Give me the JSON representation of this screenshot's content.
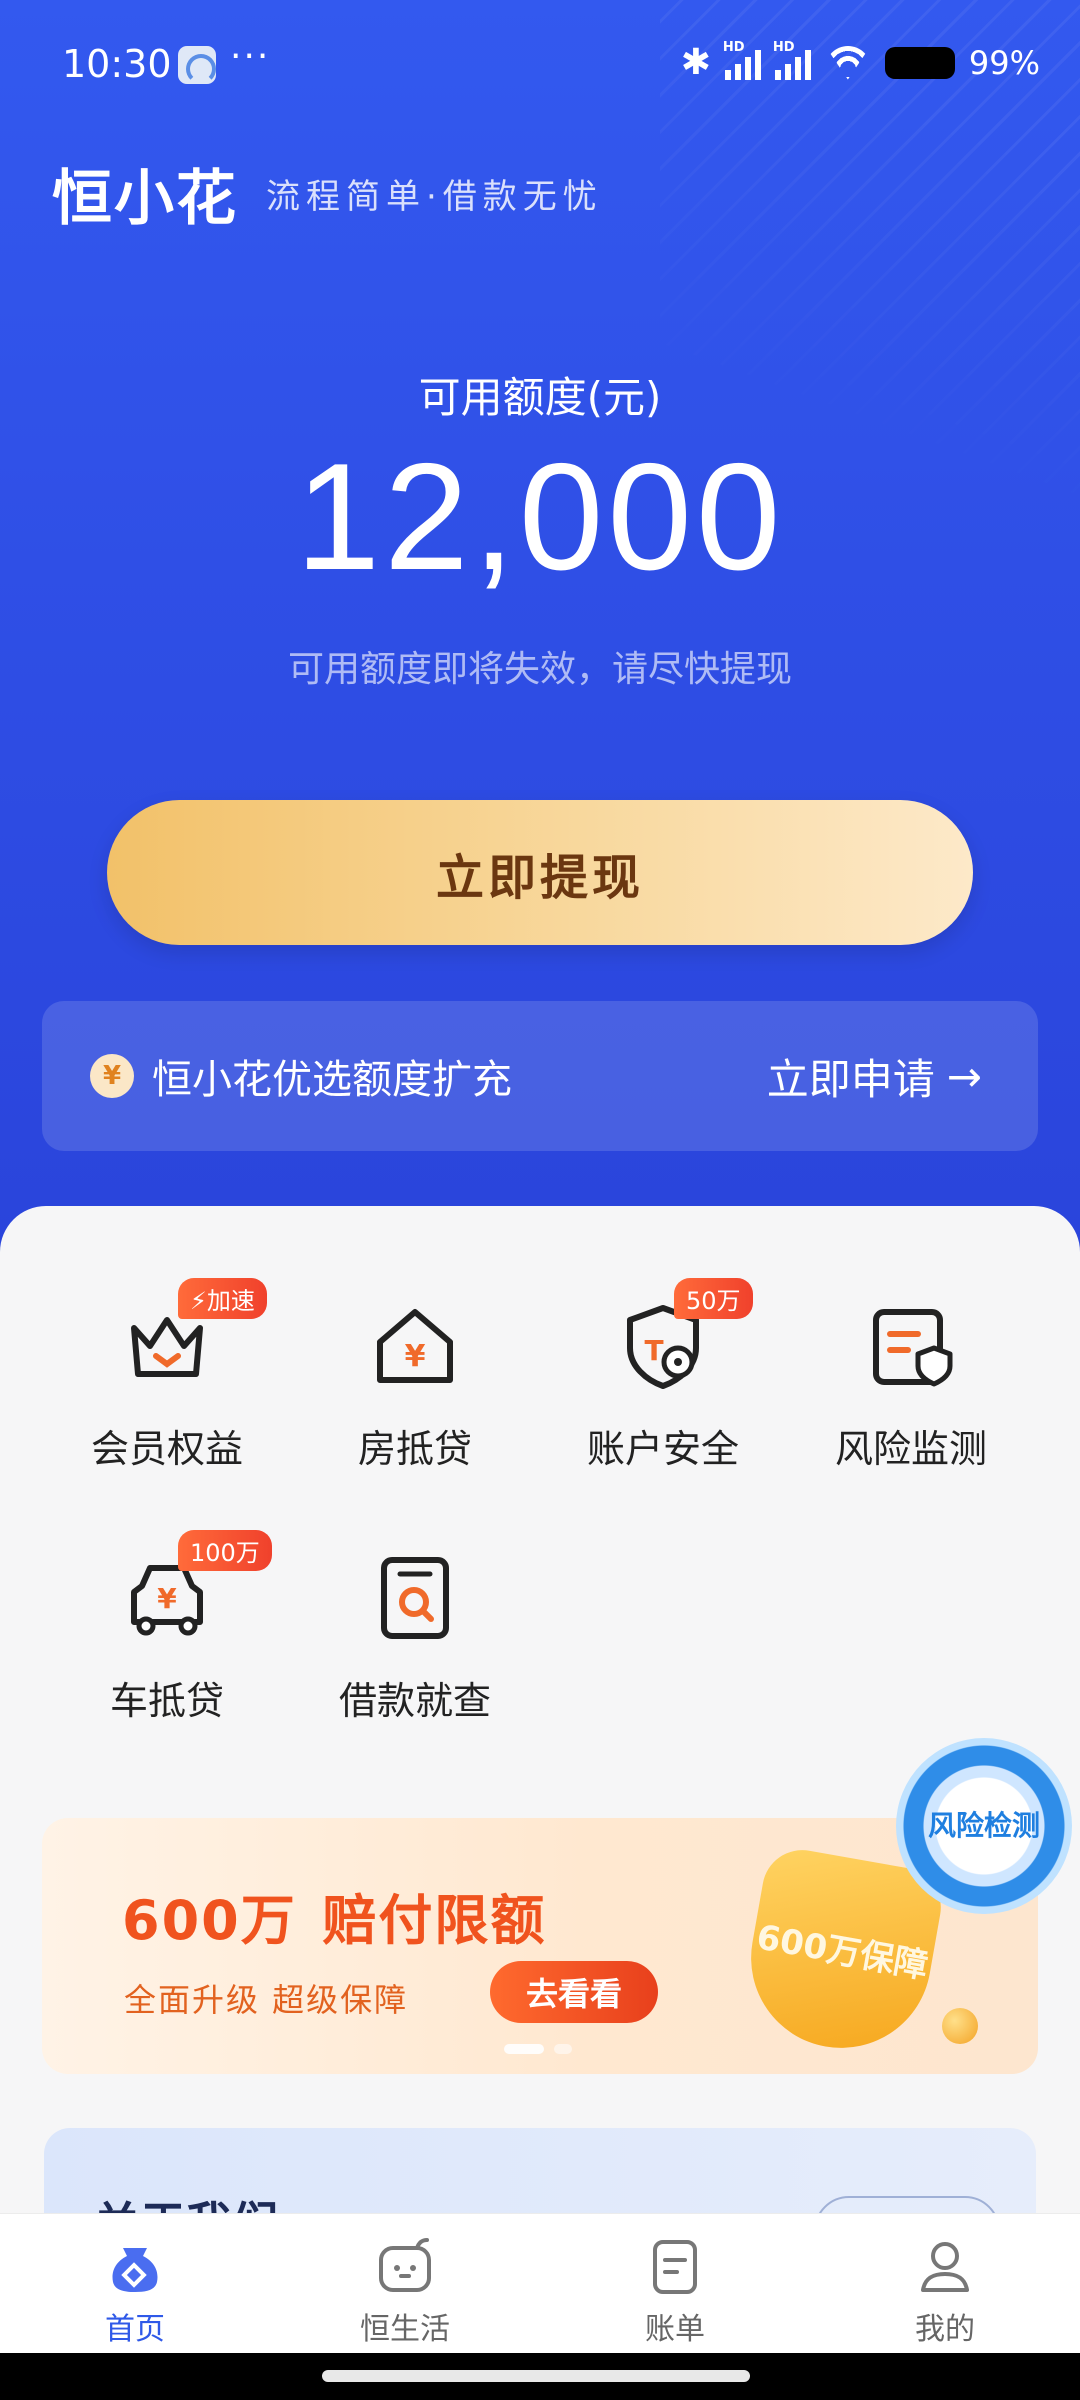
{
  "status_bar": {
    "time": "10:30",
    "more": "···",
    "hd1": "HD",
    "hd2": "HD",
    "battery": "99%",
    "icons": [
      "app-icon",
      "bluetooth-icon",
      "signal-icon",
      "wifi-icon",
      "battery-icon"
    ]
  },
  "brand": {
    "logo": "恒小花",
    "slogan": "流程简单·借款无忧"
  },
  "quota": {
    "label": "可用额度(元)",
    "amount": "12,000",
    "note": "可用额度即将失效，请尽快提现"
  },
  "withdraw_button": "立即提现",
  "promo_strip": {
    "coin": "¥",
    "text": "恒小花优选额度扩充",
    "action": "立即申请",
    "arrow": "→"
  },
  "services": [
    {
      "label": "会员权益",
      "tag": "⚡加速",
      "icon": "crown-icon"
    },
    {
      "label": "房抵贷",
      "tag": "",
      "icon": "house-yen-icon"
    },
    {
      "label": "账户安全",
      "tag": "50万",
      "icon": "shield-lock-icon"
    },
    {
      "label": "风险监测",
      "tag": "",
      "icon": "monitor-shield-icon"
    },
    {
      "label": "车抵贷",
      "tag": "100万",
      "icon": "car-yen-icon"
    },
    {
      "label": "借款就查",
      "tag": "",
      "icon": "search-doc-icon"
    }
  ],
  "banner": {
    "title_num": "600万",
    "title_text": "赔付限额",
    "subtitle": "全面升级 超级保障",
    "button": "去看看",
    "shield_text": "600万保障"
  },
  "risk_float": "风险检测",
  "about": {
    "title": "关于我们"
  },
  "tabbar": [
    {
      "label": "首页",
      "icon": "home-bag-icon",
      "active": true
    },
    {
      "label": "恒生活",
      "icon": "life-face-icon",
      "active": false
    },
    {
      "label": "账单",
      "icon": "bill-icon",
      "active": false
    },
    {
      "label": "我的",
      "icon": "profile-icon",
      "active": false
    }
  ],
  "colors": {
    "hero_blue": "#2f4fe6",
    "gold": "#f2c169",
    "accent_orange": "#f0531e",
    "tab_active": "#2f59e8"
  }
}
